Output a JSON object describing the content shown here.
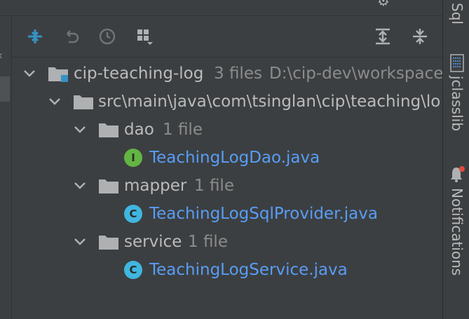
{
  "toolbar": {
    "buttons": [
      {
        "name": "expand-collapse-icon"
      },
      {
        "name": "undo-icon"
      },
      {
        "name": "history-icon"
      },
      {
        "name": "group-by-icon"
      },
      {
        "name": "expand-all-icon"
      },
      {
        "name": "collapse-all-icon"
      }
    ]
  },
  "tree": {
    "root": {
      "label": "cip-teaching-log",
      "count": "3 files",
      "path": "D:\\cip-dev\\workspace"
    },
    "pkg": {
      "label": "src\\main\\java\\com\\tsinglan\\cip\\teaching\\lo"
    },
    "groups": [
      {
        "folder": "dao",
        "count": "1 file",
        "file": "TeachingLogDao.java",
        "kind": "I",
        "kind_color": "#62b543"
      },
      {
        "folder": "mapper",
        "count": "1 file",
        "file": "TeachingLogSqlProvider.java",
        "kind": "C",
        "kind_color": "#40b6e0"
      },
      {
        "folder": "service",
        "count": "1 file",
        "file": "TeachingLogService.java",
        "kind": "C",
        "kind_color": "#40b6e0"
      }
    ]
  },
  "rightbar": {
    "sql": "Sql",
    "jclasslib": "jclasslib",
    "notifications": "Notifications"
  },
  "colors": {
    "accent": "#3592c4",
    "link": "#589df6",
    "notif_dot": "#e5493a"
  }
}
